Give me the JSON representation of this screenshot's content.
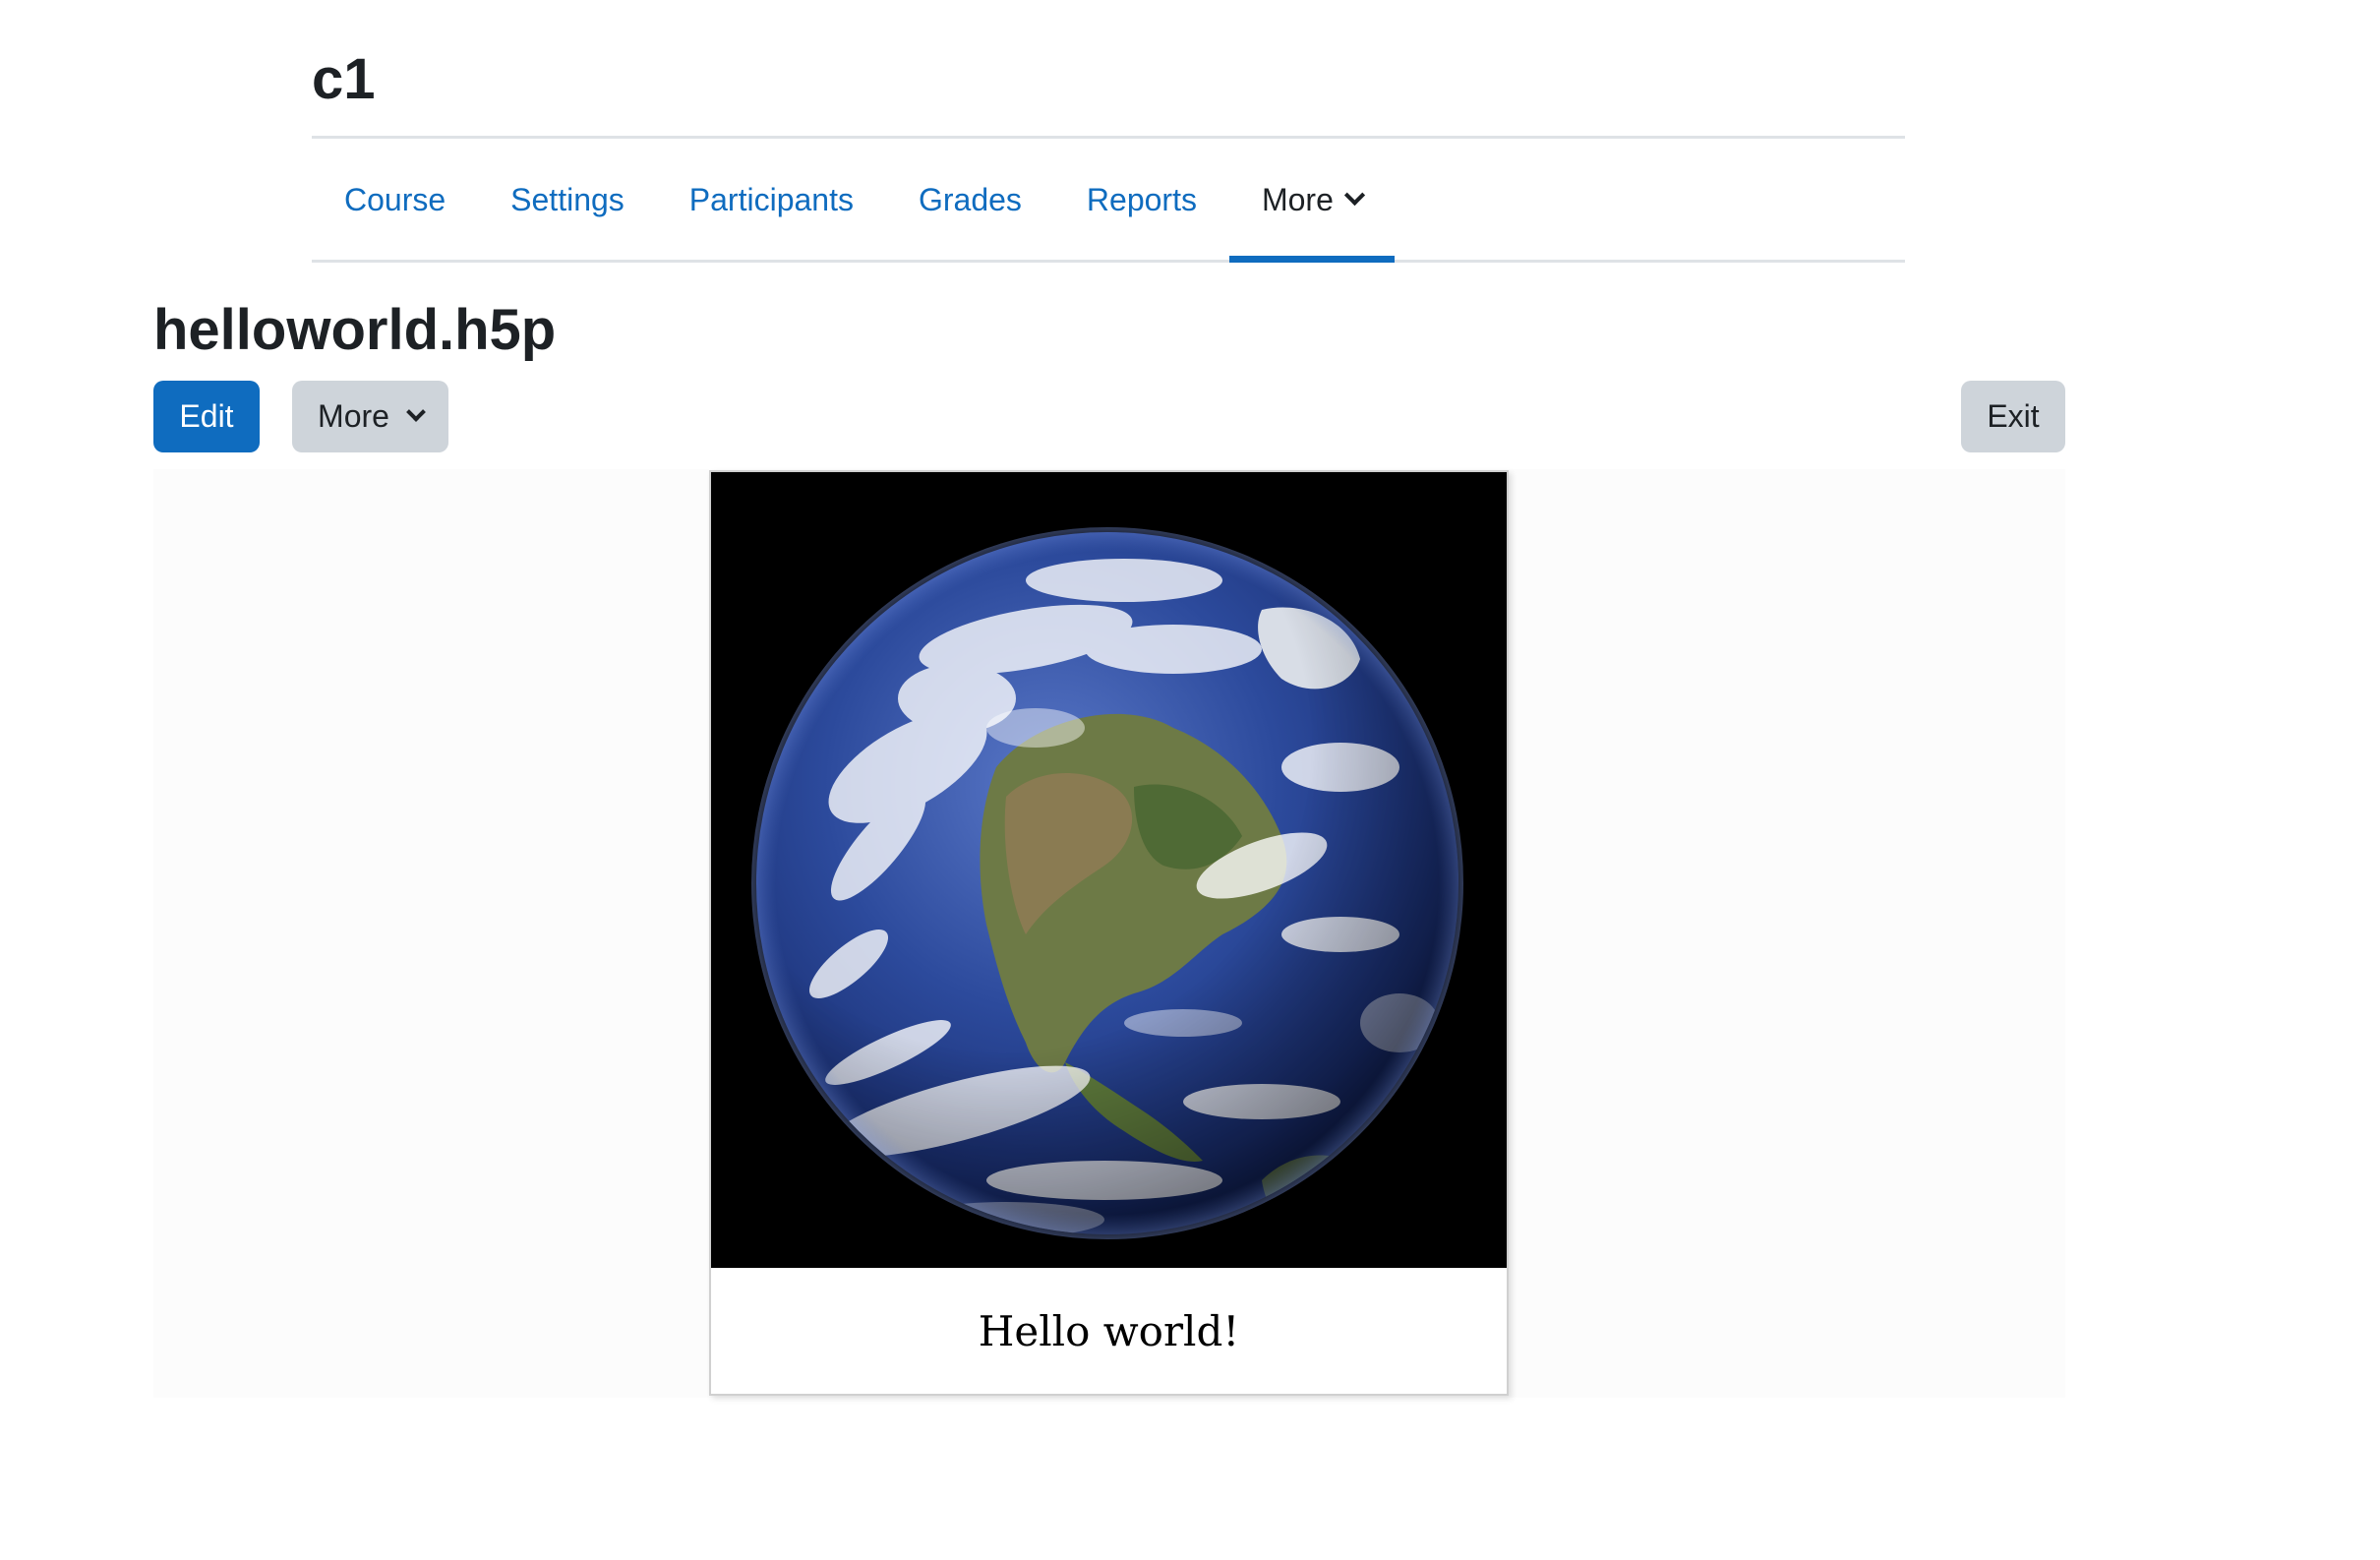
{
  "course": {
    "title": "c1"
  },
  "nav": {
    "items": [
      {
        "label": "Course"
      },
      {
        "label": "Settings"
      },
      {
        "label": "Participants"
      },
      {
        "label": "Grades"
      },
      {
        "label": "Reports"
      }
    ],
    "more_label": "More",
    "active": "More",
    "link_color": "#0f6cbf"
  },
  "activity": {
    "title": "helloworld.h5p",
    "edit_label": "Edit",
    "more_label": "More",
    "exit_label": "Exit"
  },
  "h5p": {
    "image_icon": "earth-photo",
    "caption": "Hello world!"
  },
  "colors": {
    "primary": "#0f6cbf",
    "secondary": "#ced4da"
  }
}
